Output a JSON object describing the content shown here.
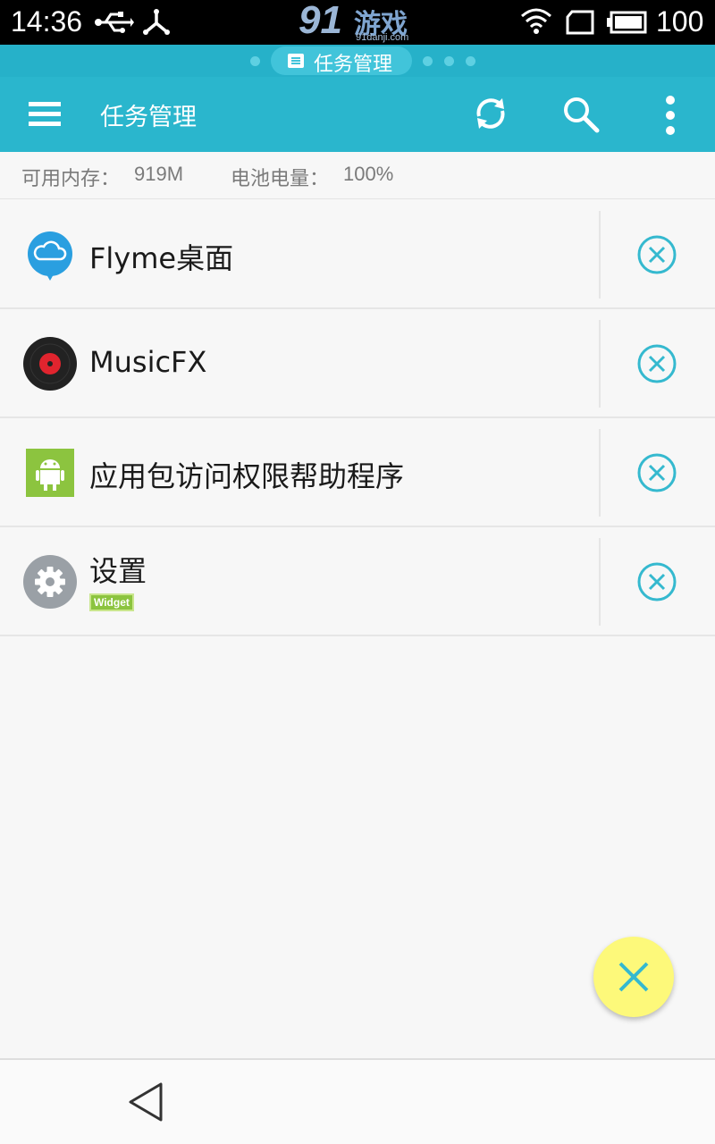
{
  "status_bar": {
    "time": "14:36",
    "battery": "100",
    "icons": [
      "usb-icon",
      "debug-icon",
      "wifi-icon",
      "sim-icon",
      "battery-icon"
    ]
  },
  "watermark": {
    "num": "91",
    "text": "游戏",
    "sub": "91danji.com"
  },
  "title_strip": {
    "label": "任务管理"
  },
  "toolbar": {
    "title": "任务管理",
    "icons": [
      "menu-icon",
      "refresh-icon",
      "search-icon",
      "more-icon"
    ]
  },
  "info": {
    "memory_label": "可用内存：",
    "memory_value": "919M",
    "battery_label": "电池电量：",
    "battery_value": "100%"
  },
  "tasks": [
    {
      "name": "Flyme桌面",
      "icon": "cloud-icon"
    },
    {
      "name": "MusicFX",
      "icon": "vinyl-icon"
    },
    {
      "name": "应用包访问权限帮助程序",
      "icon": "android-icon"
    },
    {
      "name": "设置",
      "icon": "gear-icon",
      "badge": "Widget"
    }
  ],
  "colors": {
    "accent": "#2ab6cd",
    "close_icon": "#35b9cf",
    "fab": "#fdf97a"
  }
}
